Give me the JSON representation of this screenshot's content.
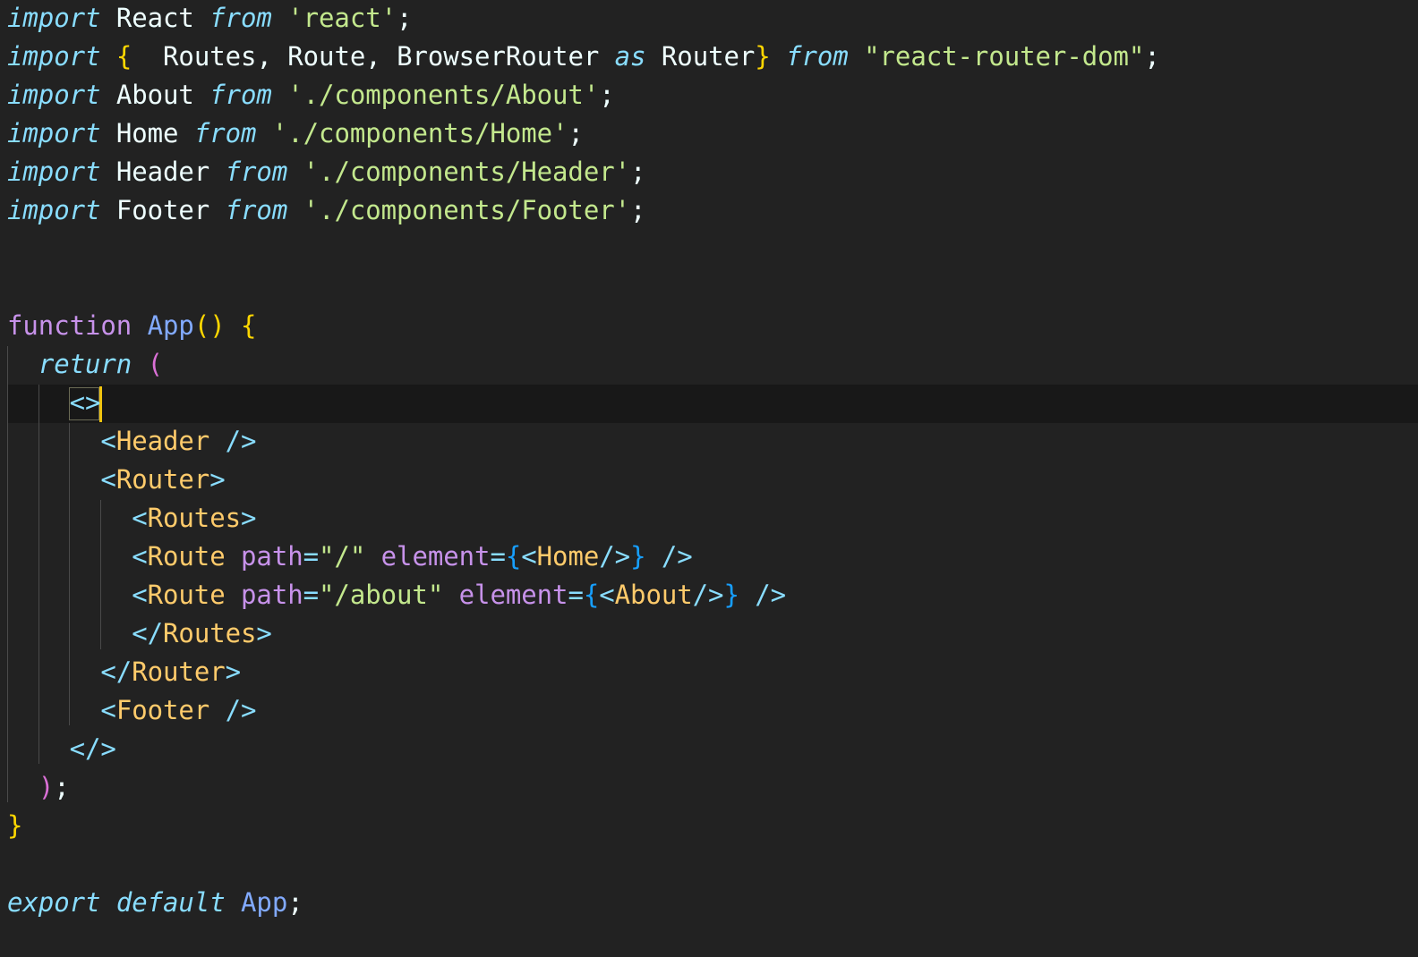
{
  "editor": {
    "language": "javascript",
    "theme_colors": {
      "background": "#222222",
      "current_line": "#181818",
      "cursor": "#f1c40f",
      "keyword": "#89ddff",
      "string": "#c3e88d",
      "tag": "#ffcb6b",
      "function": "#82aaff",
      "attribute": "#c792ea"
    },
    "lines": [
      "import React from 'react';",
      "import {  Routes, Route, BrowserRouter as Router} from \"react-router-dom\";",
      "import About from './components/About';",
      "import Home from './components/Home';",
      "import Header from './components/Header';",
      "import Footer from './components/Footer';",
      "",
      "",
      "function App() {",
      "  return (",
      "    <>",
      "      <Header />",
      "      <Router>",
      "        <Routes>",
      "        <Route path=\"/\" element={<Home/>} />",
      "        <Route path=\"/about\" element={<About/>} />",
      "        </Routes>",
      "      </Router>",
      "      <Footer />",
      "    </>",
      "  );",
      "}",
      "",
      "export default App;"
    ]
  }
}
